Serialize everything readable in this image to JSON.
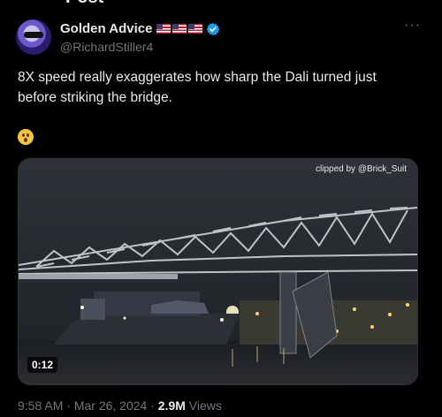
{
  "header": {
    "title": "Post"
  },
  "tweet": {
    "author_name": "Golden Advice",
    "author_handle": "@RichardStiller4",
    "text": "8X speed really exaggerates how sharp the Dali turned just before striking the bridge.",
    "emoji": "😯",
    "flag_count": 3,
    "verified": true,
    "media": {
      "credit": "clipped by @Brick_Suit",
      "duration": "0:12"
    },
    "time": "9:58 AM",
    "date": "Mar 26, 2024",
    "views_count": "2.9M",
    "views_label": "Views"
  },
  "icons": [
    "more-icon",
    "verified-badge-icon",
    "us-flag-icon",
    "astonished-emoji-icon",
    "avatar"
  ],
  "colors": {
    "background": "#000000",
    "text": "#e7e9ea",
    "muted": "#71767b",
    "verified": "#1d9bf0"
  }
}
